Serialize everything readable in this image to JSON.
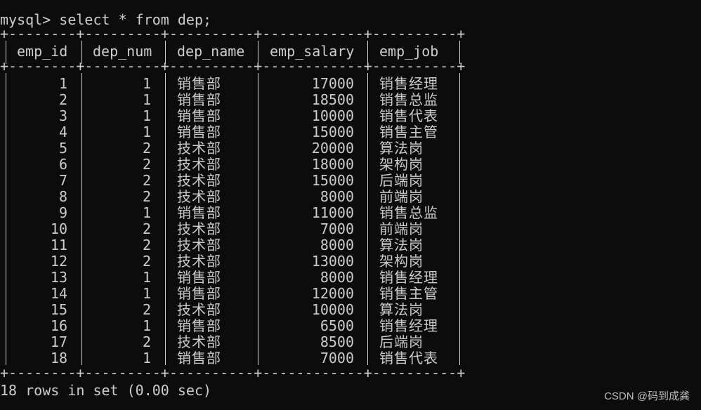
{
  "terminal": {
    "prompt_line": "mysql> select * from dep;",
    "border_line": "+--------+---------+----------+------------+----------+",
    "columns": [
      "emp_id",
      "dep_num",
      "dep_name",
      "emp_salary",
      "emp_job"
    ],
    "rows": [
      [
        "1",
        "1",
        "销售部",
        "17000",
        "销售经理"
      ],
      [
        "2",
        "1",
        "销售部",
        "18500",
        "销售总监"
      ],
      [
        "3",
        "1",
        "销售部",
        "10000",
        "销售代表"
      ],
      [
        "4",
        "1",
        "销售部",
        "15000",
        "销售主管"
      ],
      [
        "5",
        "2",
        "技术部",
        "20000",
        "算法岗"
      ],
      [
        "6",
        "2",
        "技术部",
        "18000",
        "架构岗"
      ],
      [
        "7",
        "2",
        "技术部",
        "15000",
        "后端岗"
      ],
      [
        "8",
        "2",
        "技术部",
        "8000",
        "前端岗"
      ],
      [
        "9",
        "1",
        "销售部",
        "11000",
        "销售总监"
      ],
      [
        "10",
        "2",
        "技术部",
        "7000",
        "前端岗"
      ],
      [
        "11",
        "2",
        "技术部",
        "8000",
        "算法岗"
      ],
      [
        "12",
        "2",
        "技术部",
        "13000",
        "架构岗"
      ],
      [
        "13",
        "1",
        "销售部",
        "8000",
        "销售经理"
      ],
      [
        "14",
        "1",
        "销售部",
        "12000",
        "销售主管"
      ],
      [
        "15",
        "2",
        "技术部",
        "10000",
        "算法岗"
      ],
      [
        "16",
        "1",
        "销售部",
        "6500",
        "销售经理"
      ],
      [
        "17",
        "2",
        "技术部",
        "8500",
        "后端岗"
      ],
      [
        "18",
        "1",
        "销售部",
        "7000",
        "销售代表"
      ]
    ],
    "result_line": "18 rows in set (0.00 sec)"
  },
  "watermark": "CSDN @码到成龚"
}
